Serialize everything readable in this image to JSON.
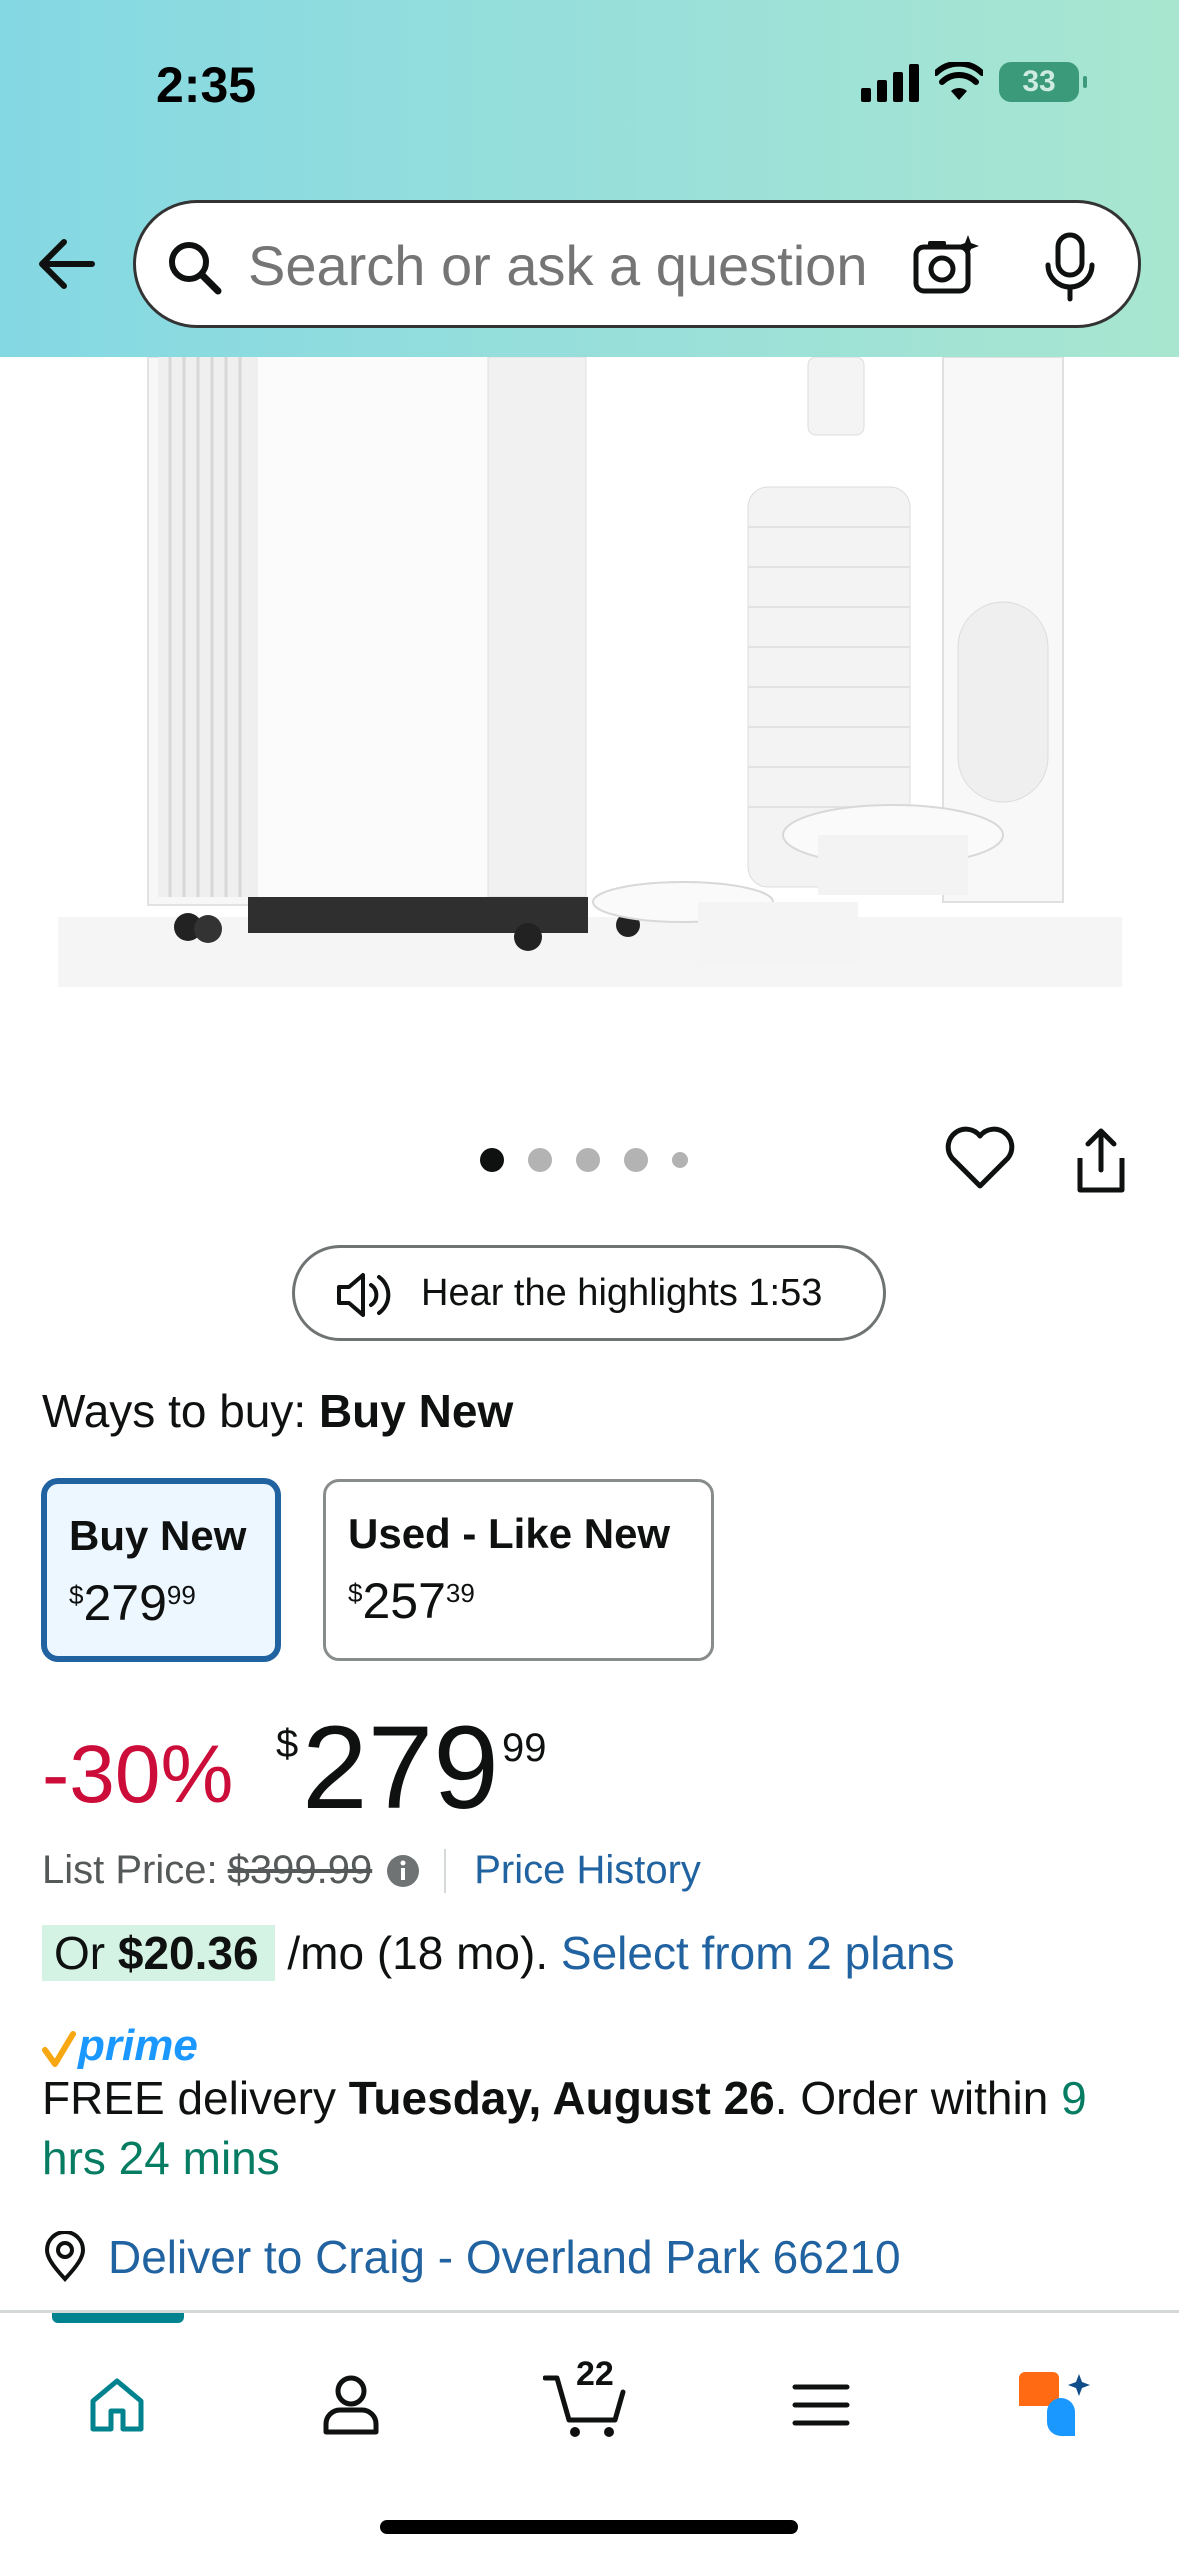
{
  "status_bar": {
    "time": "2:35",
    "battery": "33"
  },
  "search": {
    "placeholder": "Search or ask a question"
  },
  "carousel": {
    "total_images": 5,
    "active_index": 0
  },
  "highlights": {
    "label": "Hear the highlights 1:53"
  },
  "ways_to_buy": {
    "prefix": "Ways to buy:",
    "selected": "Buy New"
  },
  "options": [
    {
      "title": "Buy New",
      "currency": "$",
      "whole": "279",
      "fraction": "99",
      "selected": true
    },
    {
      "title": "Used - Like New",
      "currency": "$",
      "whole": "257",
      "fraction": "39",
      "selected": false
    }
  ],
  "price": {
    "discount": "-30%",
    "currency": "$",
    "whole": "279",
    "fraction": "99",
    "list_price_label": "List Price:",
    "list_price_value": "$399.99",
    "history_link": "Price History"
  },
  "monthly": {
    "or": "Or",
    "amount": "$20.36",
    "term": "/mo (18 mo).",
    "plans_link": "Select from 2 plans"
  },
  "prime": {
    "label": "prime"
  },
  "delivery": {
    "prefix": "FREE delivery",
    "date": "Tuesday, August 26",
    "order_within": ". Order within",
    "countdown": "9 hrs 24 mins"
  },
  "deliver_to": {
    "label": "Deliver to Craig - Overland Park 66210"
  },
  "nav": {
    "cart_count": "22",
    "active_tab": "home",
    "accent": "#00838f"
  },
  "colors": {
    "link": "#2162a1",
    "discount": "#cc0c39",
    "delivery_green": "#067d62",
    "prime_blue": "#1a98ff",
    "selected_border": "#2162a1"
  }
}
